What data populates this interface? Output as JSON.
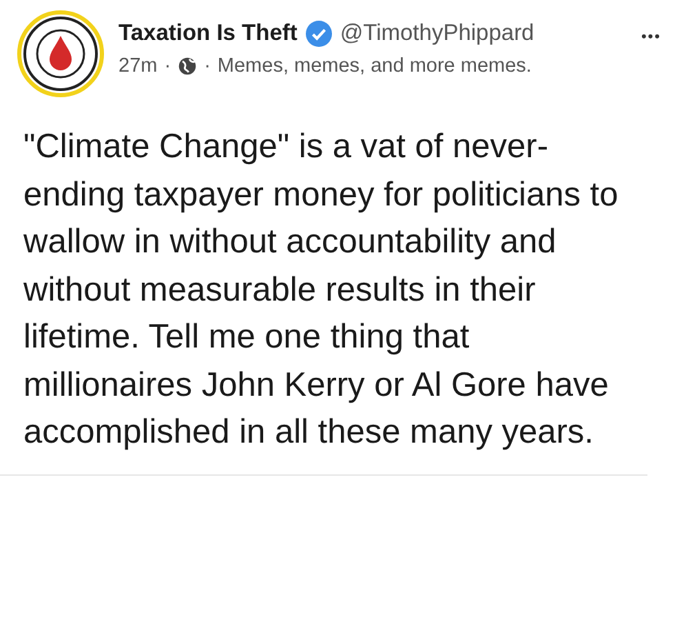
{
  "post": {
    "author": "Taxation Is Theft",
    "verified": true,
    "handle": "@TimothyPhippard",
    "time": "27m",
    "separator_1": "·",
    "separator_2": "·",
    "description": "Memes, memes, and more memes.",
    "more": "•••"
  },
  "image": {
    "text": "\"Climate Change\" is a vat of never-ending taxpayer money for politicians to wallow in without accountability and without measurable results in their lifetime. Tell me one thing that millionaires John Kerry or Al Gore have accomplished in all these many years."
  }
}
